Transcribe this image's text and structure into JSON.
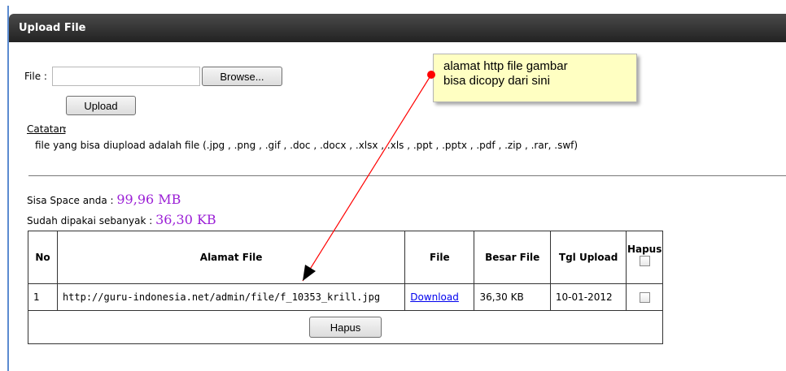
{
  "panel": {
    "title": "Upload File"
  },
  "upload_form": {
    "file_label": "File :",
    "file_value": "",
    "browse_label": "Browse...",
    "upload_label": "Upload"
  },
  "notes": {
    "catatan_label": "Catatan",
    "catatan_suffix": ":",
    "text": "file yang bisa diupload adalah file (.jpg , .png , .gif , .doc , .docx , .xlsx , .xls , .ppt , .pptx , .pdf , .zip , .rar, .swf)"
  },
  "space": {
    "remaining_label": "Sisa Space anda :",
    "remaining_value": "99,96 MB",
    "used_label": "Sudah dipakai sebanyak :",
    "used_value": "36,30 KB",
    "value_color": "#9b1fd6"
  },
  "table": {
    "headers": {
      "no": "No",
      "alamat": "Alamat File",
      "file": "File",
      "besar": "Besar File",
      "tgl": "Tgl Upload",
      "hapus": "Hapus"
    },
    "rows": [
      {
        "no": "1",
        "alamat": "http://guru-indonesia.net/admin/file/f_10353_krill.jpg",
        "file_link": "Download",
        "besar": "36,30 KB",
        "tgl": "10-01-2012",
        "checked": false
      }
    ],
    "hapus_button": "Hapus"
  },
  "annotation": {
    "text_line1": "alamat http file gambar",
    "text_line2": "bisa dicopy dari sini",
    "arrow_color": "#ff0000"
  }
}
